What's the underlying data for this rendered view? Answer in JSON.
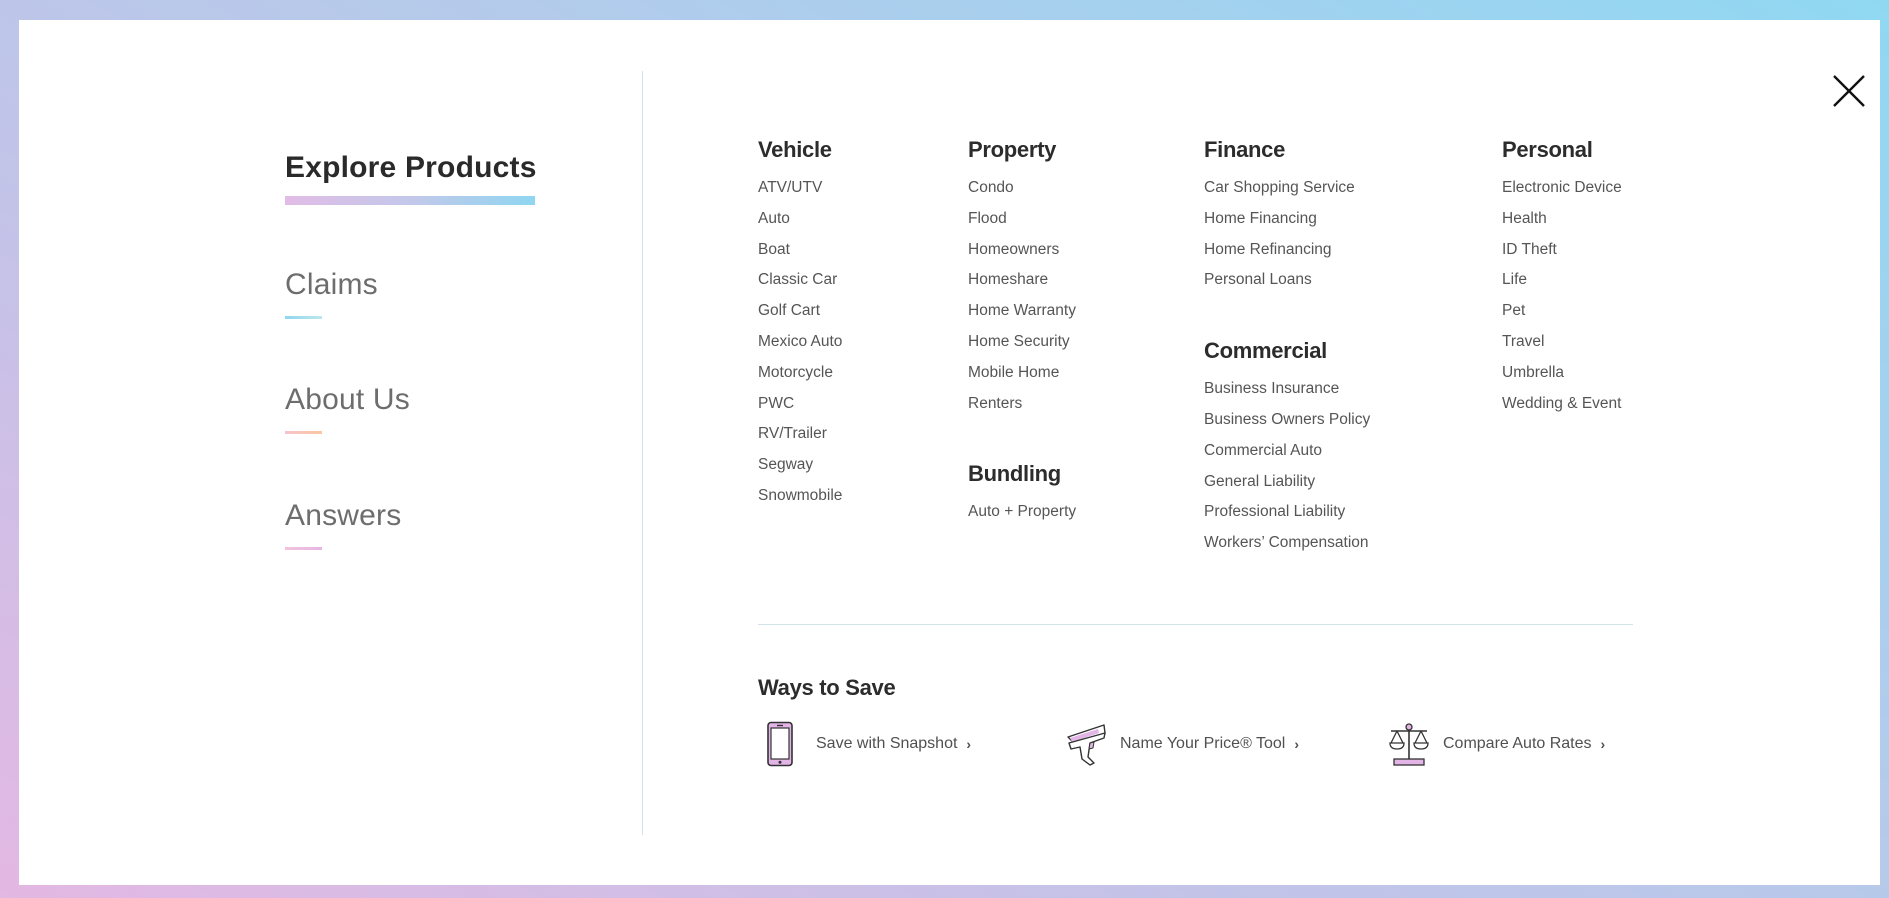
{
  "close_button": {
    "icon": "close-icon",
    "label": "Close"
  },
  "left_nav": {
    "items": [
      {
        "label": "Explore Products",
        "active": true
      },
      {
        "label": "Claims",
        "active": false
      },
      {
        "label": "About Us",
        "active": false
      },
      {
        "label": "Answers",
        "active": false
      }
    ]
  },
  "products": {
    "vehicle": {
      "title": "Vehicle",
      "items": [
        "ATV/UTV",
        "Auto",
        "Boat",
        "Classic Car",
        "Golf Cart",
        "Mexico Auto",
        "Motorcycle",
        "PWC",
        "RV/Trailer",
        "Segway",
        "Snowmobile"
      ]
    },
    "property": {
      "title": "Property",
      "items": [
        "Condo",
        "Flood",
        "Homeowners",
        "Homeshare",
        "Home Warranty",
        "Home Security",
        "Mobile Home",
        "Renters"
      ]
    },
    "bundling": {
      "title": "Bundling",
      "items": [
        "Auto + Property"
      ]
    },
    "finance": {
      "title": "Finance",
      "items": [
        "Car Shopping Service",
        "Home Financing",
        "Home Refinancing",
        "Personal Loans"
      ]
    },
    "commercial": {
      "title": "Commercial",
      "items": [
        "Business Insurance",
        "Business Owners Policy",
        "Commercial Auto",
        "General Liability",
        "Professional Liability",
        "Workers’ Compensation"
      ]
    },
    "personal": {
      "title": "Personal",
      "items": [
        "Electronic Device",
        "Health",
        "ID Theft",
        "Life",
        "Pet",
        "Travel",
        "Umbrella",
        "Wedding & Event"
      ]
    }
  },
  "ways_to_save": {
    "title": "Ways to Save",
    "items": [
      {
        "label": "Save with Snapshot",
        "icon": "phone-icon",
        "chevron": "›"
      },
      {
        "label": "Name Your Price® Tool",
        "icon": "price-gun-icon",
        "chevron": "›"
      },
      {
        "label": "Compare Auto Rates",
        "icon": "scale-icon",
        "chevron": "›"
      }
    ]
  },
  "colors": {
    "accent_pink": "#e1bce6",
    "accent_blue": "#8fd6f1",
    "icon_fill": "#e3b4e6",
    "text_dark": "#2c2c2c",
    "text_muted": "#555555",
    "divider": "#cfe3e8"
  }
}
